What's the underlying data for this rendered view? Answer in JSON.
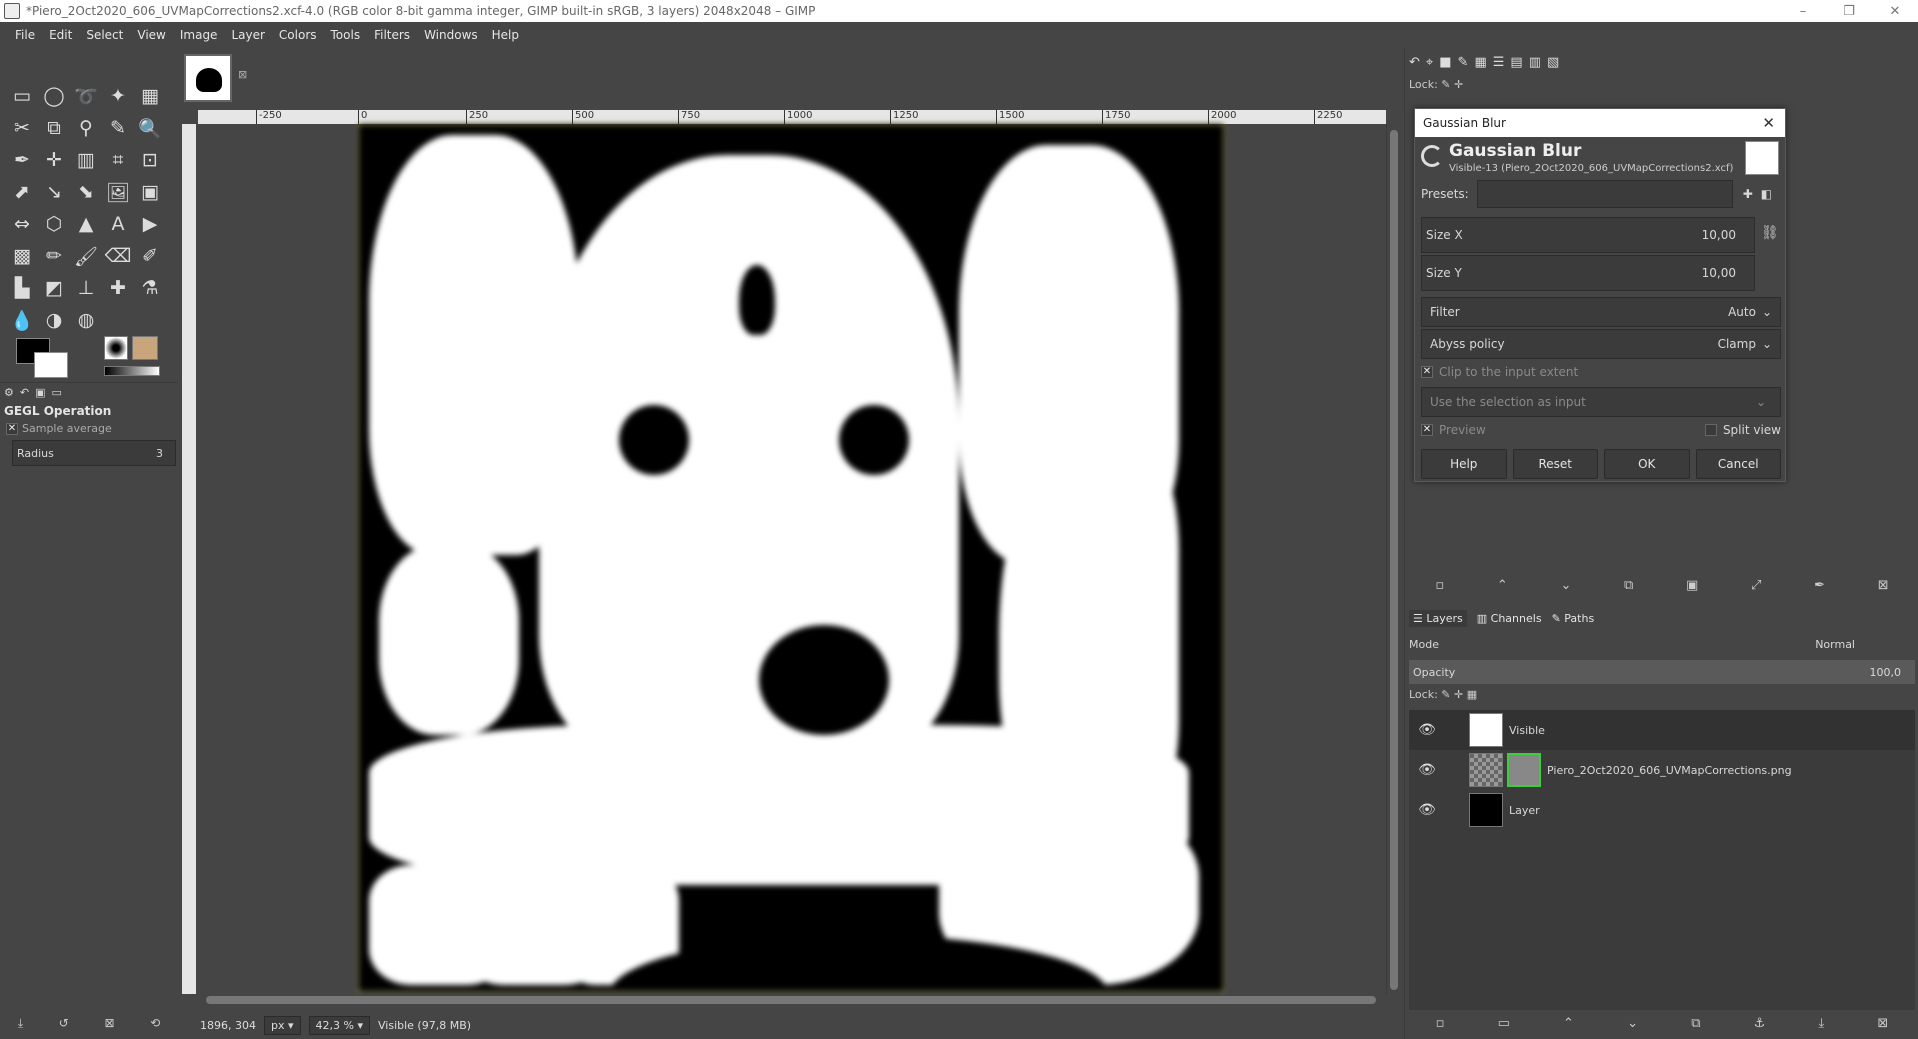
{
  "window": {
    "title": "*Piero_2Oct2020_606_UVMapCorrections2.xcf-4.0 (RGB color 8-bit gamma integer, GIMP built-in sRGB, 3 layers) 2048x2048 – GIMP",
    "minimize": "–",
    "maximize": "❐",
    "close": "✕"
  },
  "menu": [
    "File",
    "Edit",
    "Select",
    "View",
    "Image",
    "Layer",
    "Colors",
    "Tools",
    "Filters",
    "Windows",
    "Help"
  ],
  "toolbox": {
    "tools": [
      "▭",
      "◯",
      "➰",
      "✦",
      "▦",
      "✂",
      "⧉",
      "⚲",
      "✎",
      "🔍",
      "✒",
      "✛",
      "▥",
      "⌗",
      "⊡",
      "⬈",
      "↘",
      "⬊",
      "🖼",
      "▣",
      "⇔",
      "⬡",
      "▲",
      "A",
      "▶",
      "▩",
      "✏",
      "🖌",
      "⌫",
      "✐",
      "▙",
      "◩",
      "⊥",
      "✚",
      "⚗",
      "💧",
      "◑",
      "◍"
    ],
    "options_title": "GEGL Operation",
    "sample_average": "Sample average",
    "radius_label": "Radius",
    "radius_value": "3"
  },
  "canvas": {
    "ruler_ticks": [
      "-250",
      "0",
      "250",
      "500",
      "750",
      "1000",
      "1250",
      "1500",
      "1750",
      "2000",
      "2250"
    ],
    "status_coords": "1896, 304",
    "status_unit": "px",
    "status_zoom": "42,3 %",
    "status_info": "Visible (97,8 MB)"
  },
  "dialog": {
    "window_title": "Gaussian Blur",
    "heading": "Gaussian Blur",
    "subheading": "Visible-13 (Piero_2Oct2020_606_UVMapCorrections2.xcf)",
    "presets_label": "Presets:",
    "size_x_label": "Size X",
    "size_x_value": "10,00",
    "size_y_label": "Size Y",
    "size_y_value": "10,00",
    "filter_label": "Filter",
    "filter_value": "Auto",
    "abyss_label": "Abyss policy",
    "abyss_value": "Clamp",
    "clip_label": "Clip to the input extent",
    "selection_label": "Use the selection as input",
    "preview_label": "Preview",
    "split_label": "Split view",
    "buttons": {
      "help": "Help",
      "reset": "Reset",
      "ok": "OK",
      "cancel": "Cancel"
    }
  },
  "dock": {
    "lock_label": "Lock:",
    "tabs": {
      "layers": "Layers",
      "channels": "Channels",
      "paths": "Paths"
    },
    "mode_label": "Mode",
    "mode_value": "Normal",
    "opacity_label": "Opacity",
    "opacity_value": "100,0",
    "layers": [
      {
        "name": "Visible"
      },
      {
        "name": "Piero_2Oct2020_606_UVMapCorrections.png"
      },
      {
        "name": "Layer"
      }
    ]
  }
}
